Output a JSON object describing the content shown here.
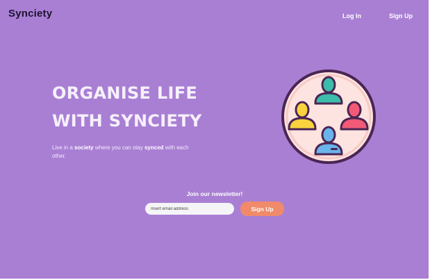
{
  "header": {
    "brand": "Synciety",
    "nav": {
      "login": "Log In",
      "signup": "Sign Up"
    }
  },
  "hero": {
    "title_line1": "ORGANISE LIFE",
    "title_line2": "WITH SYNCIETY",
    "description": {
      "part1": "Live in a ",
      "bold1": "society",
      "part2": " where you can stay ",
      "bold2": "synced",
      "part3": " with each other."
    }
  },
  "illustration": {
    "icon": "community-people-icon",
    "colors": {
      "circle": "#fde4e1",
      "outline": "#4b2553",
      "teal": "#3cbcaa",
      "yellow": "#f9d33d",
      "pink": "#f25a78",
      "blue": "#6ab4ec"
    }
  },
  "newsletter": {
    "label": "Join our newsletter!",
    "placeholder": "Insert email address",
    "button": "Sign Up"
  },
  "colors": {
    "background": "#a97fd4",
    "accent": "#f08a6a"
  }
}
